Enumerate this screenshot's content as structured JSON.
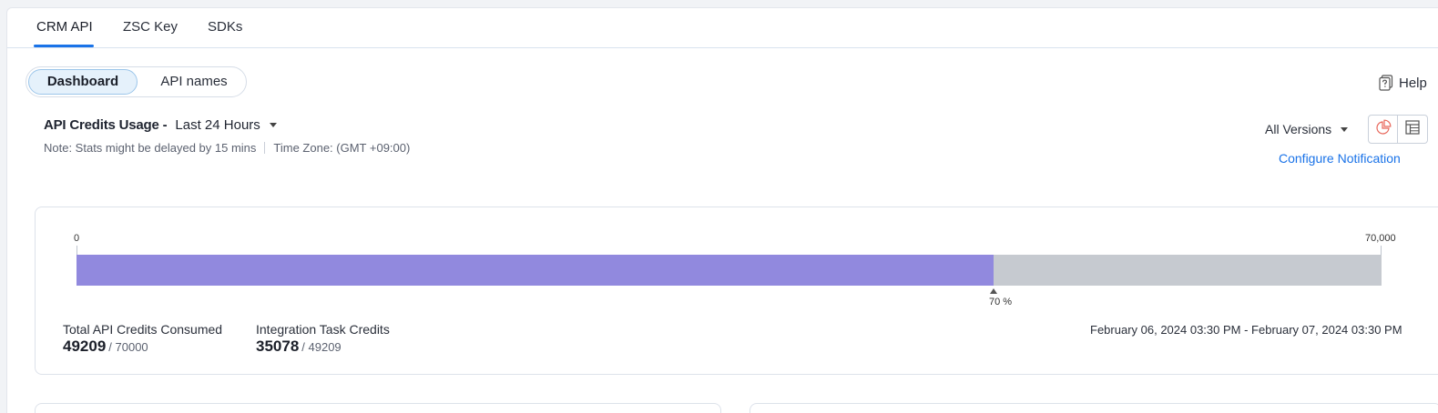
{
  "tabs": [
    {
      "label": "CRM API",
      "active": true
    },
    {
      "label": "ZSC Key",
      "active": false
    },
    {
      "label": "SDKs",
      "active": false
    }
  ],
  "view_switch": {
    "dashboard": "Dashboard",
    "api_names": "API names",
    "selected": "Dashboard"
  },
  "help": {
    "label": "Help",
    "icon": "help-icon"
  },
  "usage": {
    "title": "API Credits Usage -",
    "range": "Last 24 Hours",
    "note": "Note: Stats might be delayed by 15 mins",
    "timezone": "Time Zone: (GMT +09:00)"
  },
  "versions": {
    "label": "All Versions"
  },
  "view_toggle": {
    "chart_icon": "pie-chart-icon",
    "table_icon": "table-icon",
    "selected": "chart"
  },
  "configure_link": "Configure Notification",
  "credits_bar": {
    "min_label": "0",
    "max_label": "70,000",
    "percent_label": "70 %",
    "fraction": 0.703,
    "fill_color": "#9189de",
    "track_color": "#c6cad0"
  },
  "stats": {
    "total": {
      "label": "Total API Credits Consumed",
      "value": "49209",
      "of": "/ 70000"
    },
    "integration": {
      "label": "Integration Task Credits",
      "value": "35078",
      "of": "/ 49209"
    }
  },
  "date_range": "February 06, 2024 03:30 PM - February 07, 2024 03:30 PM",
  "colors": {
    "accent": "#1a73e8",
    "pill_active_bg": "#e5f1fb"
  }
}
